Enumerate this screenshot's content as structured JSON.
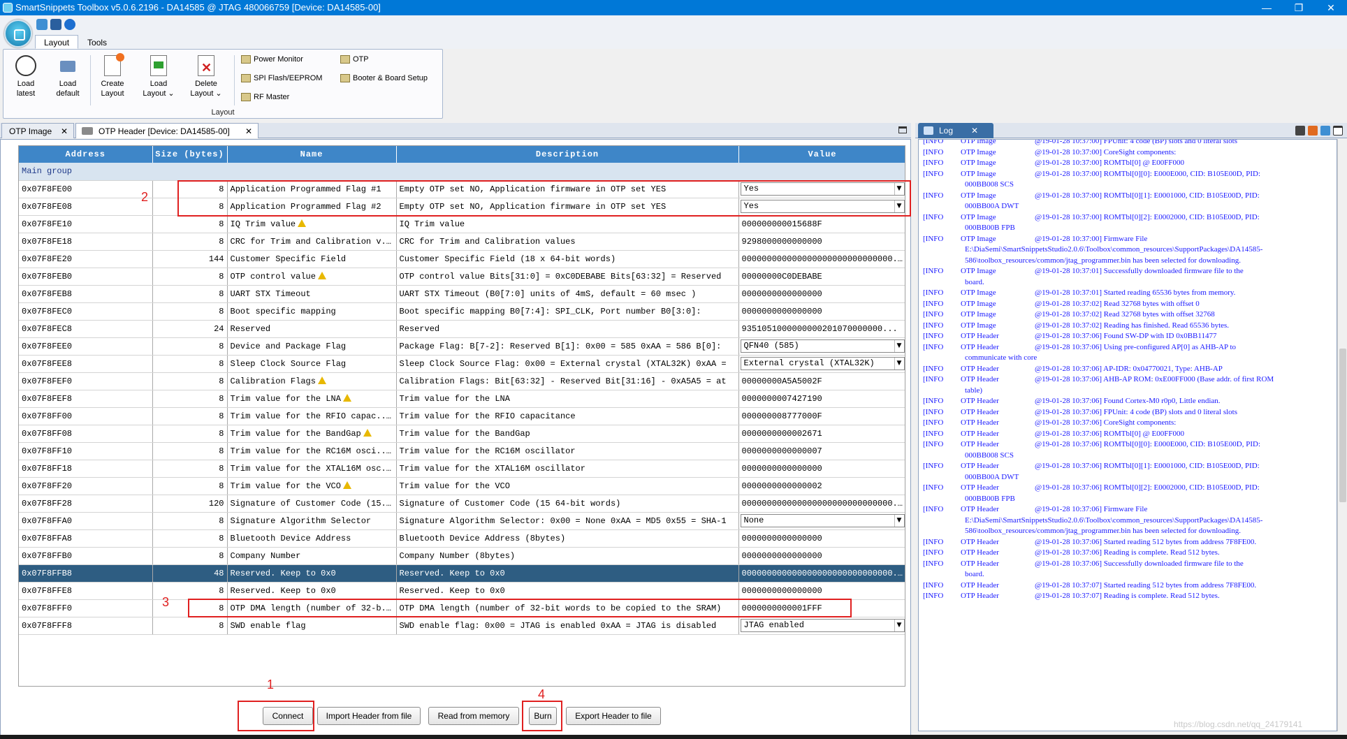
{
  "window": {
    "title": "SmartSnippets Toolbox v5.0.6.2196 - DA14585 @ JTAG 480066759 [Device: DA14585-00]",
    "controls": [
      "—",
      "❐",
      "✕"
    ]
  },
  "ribbon": {
    "tabs": [
      "Layout",
      "Tools"
    ],
    "buttons": [
      {
        "line1": "Load",
        "line2": "latest"
      },
      {
        "line1": "Load",
        "line2": "default"
      },
      {
        "line1": "Create",
        "line2": "Layout"
      },
      {
        "line1": "Load",
        "line2": "Layout ⌄"
      },
      {
        "line1": "Delete",
        "line2": "Layout ⌄"
      }
    ],
    "small": [
      "Power Monitor",
      "SPI Flash/EEPROM",
      "RF Master",
      "OTP",
      "Booter & Board Setup"
    ],
    "group_label": "Layout"
  },
  "doc_tabs": [
    "OTP Image",
    "OTP Header [Device: DA14585-00]"
  ],
  "table": {
    "headers": [
      "Address",
      "Size (bytes)",
      "Name",
      "Description",
      "Value"
    ],
    "group": "Main group",
    "rows": [
      {
        "addr": "0x07F8FE00",
        "size": "8",
        "name": "Application Programmed Flag #1",
        "warn": false,
        "desc": "Empty OTP set NO, Application firmware in OTP set YES",
        "value": "Yes",
        "combo": true
      },
      {
        "addr": "0x07F8FE08",
        "size": "8",
        "name": "Application Programmed Flag #2",
        "warn": false,
        "desc": "Empty OTP set NO, Application firmware in OTP set YES",
        "value": "Yes",
        "combo": true
      },
      {
        "addr": "0x07F8FE10",
        "size": "8",
        "name": "IQ Trim value",
        "warn": true,
        "desc": "IQ Trim value",
        "value": "000000000015688F",
        "combo": false
      },
      {
        "addr": "0x07F8FE18",
        "size": "8",
        "name": "CRC for Trim and Calibration v...",
        "warn": false,
        "desc": "CRC for Trim and Calibration values",
        "value": "9298000000000000",
        "combo": false
      },
      {
        "addr": "0x07F8FE20",
        "size": "144",
        "name": "Customer Specific Field",
        "warn": false,
        "desc": "Customer Specific Field (18 x 64-bit words)",
        "value": "000000000000000000000000000000...",
        "combo": false
      },
      {
        "addr": "0x07F8FEB0",
        "size": "8",
        "name": "OTP control value",
        "warn": true,
        "desc": "OTP control value Bits[31:0] = 0xC0DEBABE Bits[63:32] = Reserved",
        "value": "00000000C0DEBABE",
        "combo": false
      },
      {
        "addr": "0x07F8FEB8",
        "size": "8",
        "name": "UART STX Timeout",
        "warn": false,
        "desc": "UART STX Timeout (B0[7:0] units of 4mS, default = 60 msec )",
        "value": "0000000000000000",
        "combo": false
      },
      {
        "addr": "0x07F8FEC0",
        "size": "8",
        "name": "Boot specific mapping",
        "warn": false,
        "desc": "Boot specific mapping B0[7:4]: SPI_CLK, Port number B0[3:0]:",
        "value": "0000000000000000",
        "combo": false
      },
      {
        "addr": "0x07F8FEC8",
        "size": "24",
        "name": "Reserved",
        "warn": false,
        "desc": "Reserved",
        "value": "9351051000000000201070000000...",
        "combo": false
      },
      {
        "addr": "0x07F8FEE0",
        "size": "8",
        "name": "Device and Package Flag",
        "warn": false,
        "desc": "Package Flag: B[7-2]: Reserved B[1]: 0x00 = 585 0xAA = 586 B[0]:",
        "value": "QFN40 (585)",
        "combo": true
      },
      {
        "addr": "0x07F8FEE8",
        "size": "8",
        "name": "Sleep Clock Source Flag",
        "warn": false,
        "desc": "Sleep Clock Source Flag: 0x00 = External crystal (XTAL32K) 0xAA =",
        "value": "External crystal (XTAL32K)",
        "combo": true
      },
      {
        "addr": "0x07F8FEF0",
        "size": "8",
        "name": "Calibration Flags",
        "warn": true,
        "desc": "Calibration Flags: Bit[63:32] - Reserved Bit[31:16] - 0xA5A5 = at",
        "value": "00000000A5A5002F",
        "combo": false
      },
      {
        "addr": "0x07F8FEF8",
        "size": "8",
        "name": "Trim value for the LNA",
        "warn": true,
        "desc": "Trim value for the LNA",
        "value": "0000000007427190",
        "combo": false
      },
      {
        "addr": "0x07F8FF00",
        "size": "8",
        "name": "Trim value for the RFIO capac...",
        "warn": true,
        "desc": "Trim value for the RFIO capacitance",
        "value": "000000008777000F",
        "combo": false
      },
      {
        "addr": "0x07F8FF08",
        "size": "8",
        "name": "Trim value for the BandGap",
        "warn": true,
        "desc": "Trim value for the BandGap",
        "value": "0000000000002671",
        "combo": false
      },
      {
        "addr": "0x07F8FF10",
        "size": "8",
        "name": "Trim value for the RC16M osci...",
        "warn": true,
        "desc": "Trim value for the RC16M oscillator",
        "value": "0000000000000007",
        "combo": false
      },
      {
        "addr": "0x07F8FF18",
        "size": "8",
        "name": "Trim value for the XTAL16M osc...",
        "warn": false,
        "desc": "Trim value for the XTAL16M oscillator",
        "value": "0000000000000000",
        "combo": false
      },
      {
        "addr": "0x07F8FF20",
        "size": "8",
        "name": "Trim value for the VCO",
        "warn": true,
        "desc": "Trim value for the VCO",
        "value": "0000000000000002",
        "combo": false
      },
      {
        "addr": "0x07F8FF28",
        "size": "120",
        "name": "Signature of Customer Code (15...",
        "warn": false,
        "desc": "Signature of Customer Code (15 64-bit words)",
        "value": "000000000000000000000000000000...",
        "combo": false
      },
      {
        "addr": "0x07F8FFA0",
        "size": "8",
        "name": "Signature Algorithm Selector",
        "warn": false,
        "desc": "Signature Algorithm Selector: 0x00 = None 0xAA = MD5 0x55 = SHA-1",
        "value": "None",
        "combo": true
      },
      {
        "addr": "0x07F8FFA8",
        "size": "8",
        "name": "Bluetooth Device Address",
        "warn": false,
        "desc": "Bluetooth Device Address (8bytes)",
        "value": "0000000000000000",
        "combo": false
      },
      {
        "addr": "0x07F8FFB0",
        "size": "8",
        "name": "Company Number",
        "warn": false,
        "desc": "Company Number (8bytes)",
        "value": "0000000000000000",
        "combo": false
      },
      {
        "addr": "0x07F8FFB8",
        "size": "48",
        "name": "Reserved. Keep to 0x0",
        "warn": false,
        "desc": "Reserved. Keep to 0x0",
        "value": "000000000000000000000000000000...",
        "combo": false,
        "selected": true
      },
      {
        "addr": "0x07F8FFE8",
        "size": "8",
        "name": "Reserved. Keep to 0x0",
        "warn": false,
        "desc": "Reserved. Keep to 0x0",
        "value": "0000000000000000",
        "combo": false
      },
      {
        "addr": "0x07F8FFF0",
        "size": "8",
        "name": "OTP DMA length (number of 32-b...",
        "warn": false,
        "desc": "OTP DMA length (number of 32-bit words to be copied to the SRAM)",
        "value": "0000000000001FFF",
        "combo": false
      },
      {
        "addr": "0x07F8FFF8",
        "size": "8",
        "name": "SWD enable flag",
        "warn": false,
        "desc": "SWD enable flag: 0x00 = JTAG is enabled 0xAA = JTAG is disabled",
        "value": "JTAG enabled",
        "combo": true
      }
    ]
  },
  "buttons": {
    "connect": "Connect",
    "import": "Import Header from file",
    "read": "Read from memory",
    "burn": "Burn",
    "export": "Export Header to file"
  },
  "annotations": [
    "1",
    "2",
    "3",
    "4"
  ],
  "log": {
    "tab": "Log",
    "lines": [
      {
        "lv": "[INFO",
        "src": "OTP Image",
        "msg": "@19-01-28 10:37:00] FPUnit: 4 code (BP) slots and 0 literal slots"
      },
      {
        "lv": "[INFO",
        "src": "OTP Image",
        "msg": "@19-01-28 10:37:00] CoreSight components:"
      },
      {
        "lv": "[INFO",
        "src": "OTP Image",
        "msg": "@19-01-28 10:37:00] ROMTbl[0] @ E00FF000"
      },
      {
        "lv": "[INFO",
        "src": "OTP Image",
        "msg": "@19-01-28 10:37:00] ROMTbl[0][0]: E000E000, CID: B105E00D, PID:",
        "cont": [
          "000BB008 SCS"
        ]
      },
      {
        "lv": "[INFO",
        "src": "OTP Image",
        "msg": "@19-01-28 10:37:00] ROMTbl[0][1]: E0001000, CID: B105E00D, PID:",
        "cont": [
          "000BB00A DWT"
        ]
      },
      {
        "lv": "[INFO",
        "src": "OTP Image",
        "msg": "@19-01-28 10:37:00] ROMTbl[0][2]: E0002000, CID: B105E00D, PID:",
        "cont": [
          "000BB00B FPB"
        ]
      },
      {
        "lv": "[INFO",
        "src": "OTP Image",
        "msg": "@19-01-28 10:37:00] Firmware File",
        "cont": [
          "E:\\DiaSemi\\SmartSnippetsStudio2.0.6\\Toolbox\\common_resources\\SupportPackages\\DA14585-",
          "586\\toolbox_resources/common/jtag_programmer.bin has been selected for downloading."
        ]
      },
      {
        "lv": "[INFO",
        "src": "OTP Image",
        "msg": "@19-01-28 10:37:01] Successfully downloaded firmware file to the",
        "cont": [
          "board."
        ]
      },
      {
        "lv": "[INFO",
        "src": "OTP Image",
        "msg": "@19-01-28 10:37:01] Started reading 65536 bytes from memory."
      },
      {
        "lv": "[INFO",
        "src": "OTP Image",
        "msg": "@19-01-28 10:37:02] Read 32768 bytes with offset 0"
      },
      {
        "lv": "[INFO",
        "src": "OTP Image",
        "msg": "@19-01-28 10:37:02] Read 32768 bytes with offset 32768"
      },
      {
        "lv": "[INFO",
        "src": "OTP Image",
        "msg": "@19-01-28 10:37:02] Reading has finished. Read 65536 bytes."
      },
      {
        "lv": "[INFO",
        "src": "OTP Header",
        "msg": "@19-01-28 10:37:06] Found SW-DP with ID 0x0BB11477"
      },
      {
        "lv": "[INFO",
        "src": "OTP Header",
        "msg": "@19-01-28 10:37:06] Using pre-configured AP[0] as AHB-AP to",
        "cont": [
          "communicate with core"
        ]
      },
      {
        "lv": "[INFO",
        "src": "OTP Header",
        "msg": "@19-01-28 10:37:06] AP-IDR: 0x04770021, Type: AHB-AP"
      },
      {
        "lv": "[INFO",
        "src": "OTP Header",
        "msg": "@19-01-28 10:37:06] AHB-AP ROM: 0xE00FF000 (Base addr. of first ROM",
        "cont": [
          "table)"
        ]
      },
      {
        "lv": "[INFO",
        "src": "OTP Header",
        "msg": "@19-01-28 10:37:06] Found Cortex-M0 r0p0, Little endian."
      },
      {
        "lv": "[INFO",
        "src": "OTP Header",
        "msg": "@19-01-28 10:37:06] FPUnit: 4 code (BP) slots and 0 literal slots"
      },
      {
        "lv": "[INFO",
        "src": "OTP Header",
        "msg": "@19-01-28 10:37:06] CoreSight components:"
      },
      {
        "lv": "[INFO",
        "src": "OTP Header",
        "msg": "@19-01-28 10:37:06] ROMTbl[0] @ E00FF000"
      },
      {
        "lv": "[INFO",
        "src": "OTP Header",
        "msg": "@19-01-28 10:37:06] ROMTbl[0][0]: E000E000, CID: B105E00D, PID:",
        "cont": [
          "000BB008 SCS"
        ]
      },
      {
        "lv": "[INFO",
        "src": "OTP Header",
        "msg": "@19-01-28 10:37:06] ROMTbl[0][1]: E0001000, CID: B105E00D, PID:",
        "cont": [
          "000BB00A DWT"
        ]
      },
      {
        "lv": "[INFO",
        "src": "OTP Header",
        "msg": "@19-01-28 10:37:06] ROMTbl[0][2]: E0002000, CID: B105E00D, PID:",
        "cont": [
          "000BB00B FPB"
        ]
      },
      {
        "lv": "[INFO",
        "src": "OTP Header",
        "msg": "@19-01-28 10:37:06] Firmware File",
        "cont": [
          "E:\\DiaSemi\\SmartSnippetsStudio2.0.6\\Toolbox\\common_resources\\SupportPackages\\DA14585-",
          "586\\toolbox_resources/common/jtag_programmer.bin has been selected for downloading."
        ]
      },
      {
        "lv": "[INFO",
        "src": "OTP Header",
        "msg": "@19-01-28 10:37:06] Started reading 512 bytes from address 7F8FE00."
      },
      {
        "lv": "[INFO",
        "src": "OTP Header",
        "msg": "@19-01-28 10:37:06] Reading is complete. Read  512 bytes."
      },
      {
        "lv": "[INFO",
        "src": "OTP Header",
        "msg": "@19-01-28 10:37:06] Successfully downloaded firmware file to the",
        "cont": [
          "board."
        ]
      },
      {
        "lv": "[INFO",
        "src": "OTP Header",
        "msg": "@19-01-28 10:37:07] Started reading 512 bytes from address 7F8FE00."
      },
      {
        "lv": "[INFO",
        "src": "OTP Header",
        "msg": "@19-01-28 10:37:07] Reading is complete. Read  512 bytes."
      }
    ]
  },
  "watermark": "https://blog.csdn.net/qq_24179141"
}
